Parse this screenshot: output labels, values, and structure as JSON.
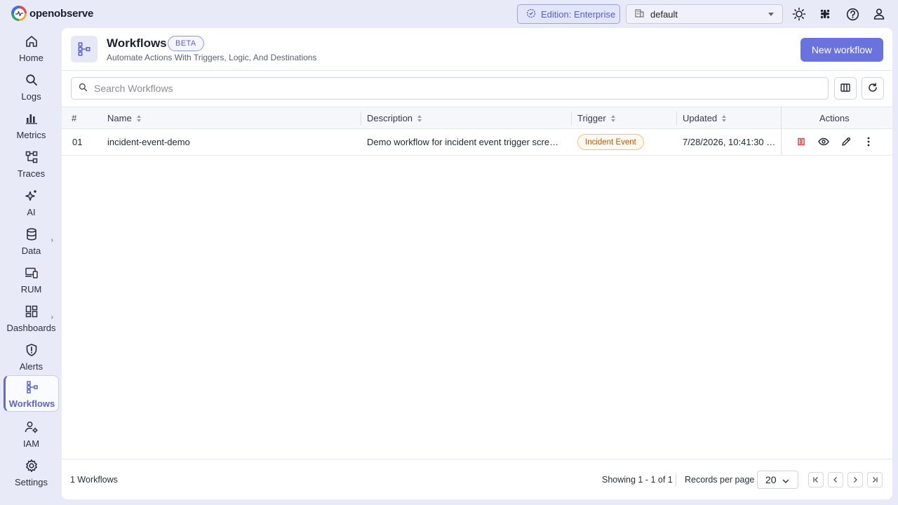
{
  "app": {
    "logo_text": "openobserve",
    "edition_label": "Edition: Enterprise",
    "org_value": "default"
  },
  "sidebar": {
    "items": [
      {
        "label": "Home",
        "icon": "home-icon"
      },
      {
        "label": "Logs",
        "icon": "search-icon"
      },
      {
        "label": "Metrics",
        "icon": "bar-chart-icon"
      },
      {
        "label": "Traces",
        "icon": "traces-icon"
      },
      {
        "label": "AI",
        "icon": "sparkle-icon"
      },
      {
        "label": "Data",
        "icon": "database-icon"
      },
      {
        "label": "RUM",
        "icon": "devices-icon"
      },
      {
        "label": "Dashboards",
        "icon": "dashboard-icon"
      },
      {
        "label": "Alerts",
        "icon": "alert-shield-icon"
      },
      {
        "label": "Workflows",
        "icon": "workflow-icon"
      },
      {
        "label": "IAM",
        "icon": "user-gear-icon"
      },
      {
        "label": "Settings",
        "icon": "gear-icon"
      }
    ],
    "active": "Workflows"
  },
  "header": {
    "title": "Workflows",
    "badge": "BETA",
    "subtitle": "Automate Actions With Triggers, Logic, And Destinations",
    "new_button": "New workflow"
  },
  "search": {
    "placeholder": "Search Workflows",
    "value": ""
  },
  "table": {
    "columns": [
      "#",
      "Name",
      "Description",
      "Trigger",
      "Updated",
      "Actions"
    ],
    "rows": [
      {
        "index": "01",
        "name": "incident-event-demo",
        "description": "Demo workflow for incident event trigger scre…",
        "trigger": "Incident Event",
        "updated": "7/28/2026, 10:41:30 …"
      }
    ]
  },
  "footer": {
    "count": "1 Workflows",
    "showing": "Showing 1 - 1 of 1",
    "rpp_label": "Records per page",
    "rpp_value": "20"
  },
  "colors": {
    "accent": "#6a72de",
    "background": "#e8eaf7",
    "trigger_badge": "#b55a12",
    "pause_red": "#e0393e"
  }
}
